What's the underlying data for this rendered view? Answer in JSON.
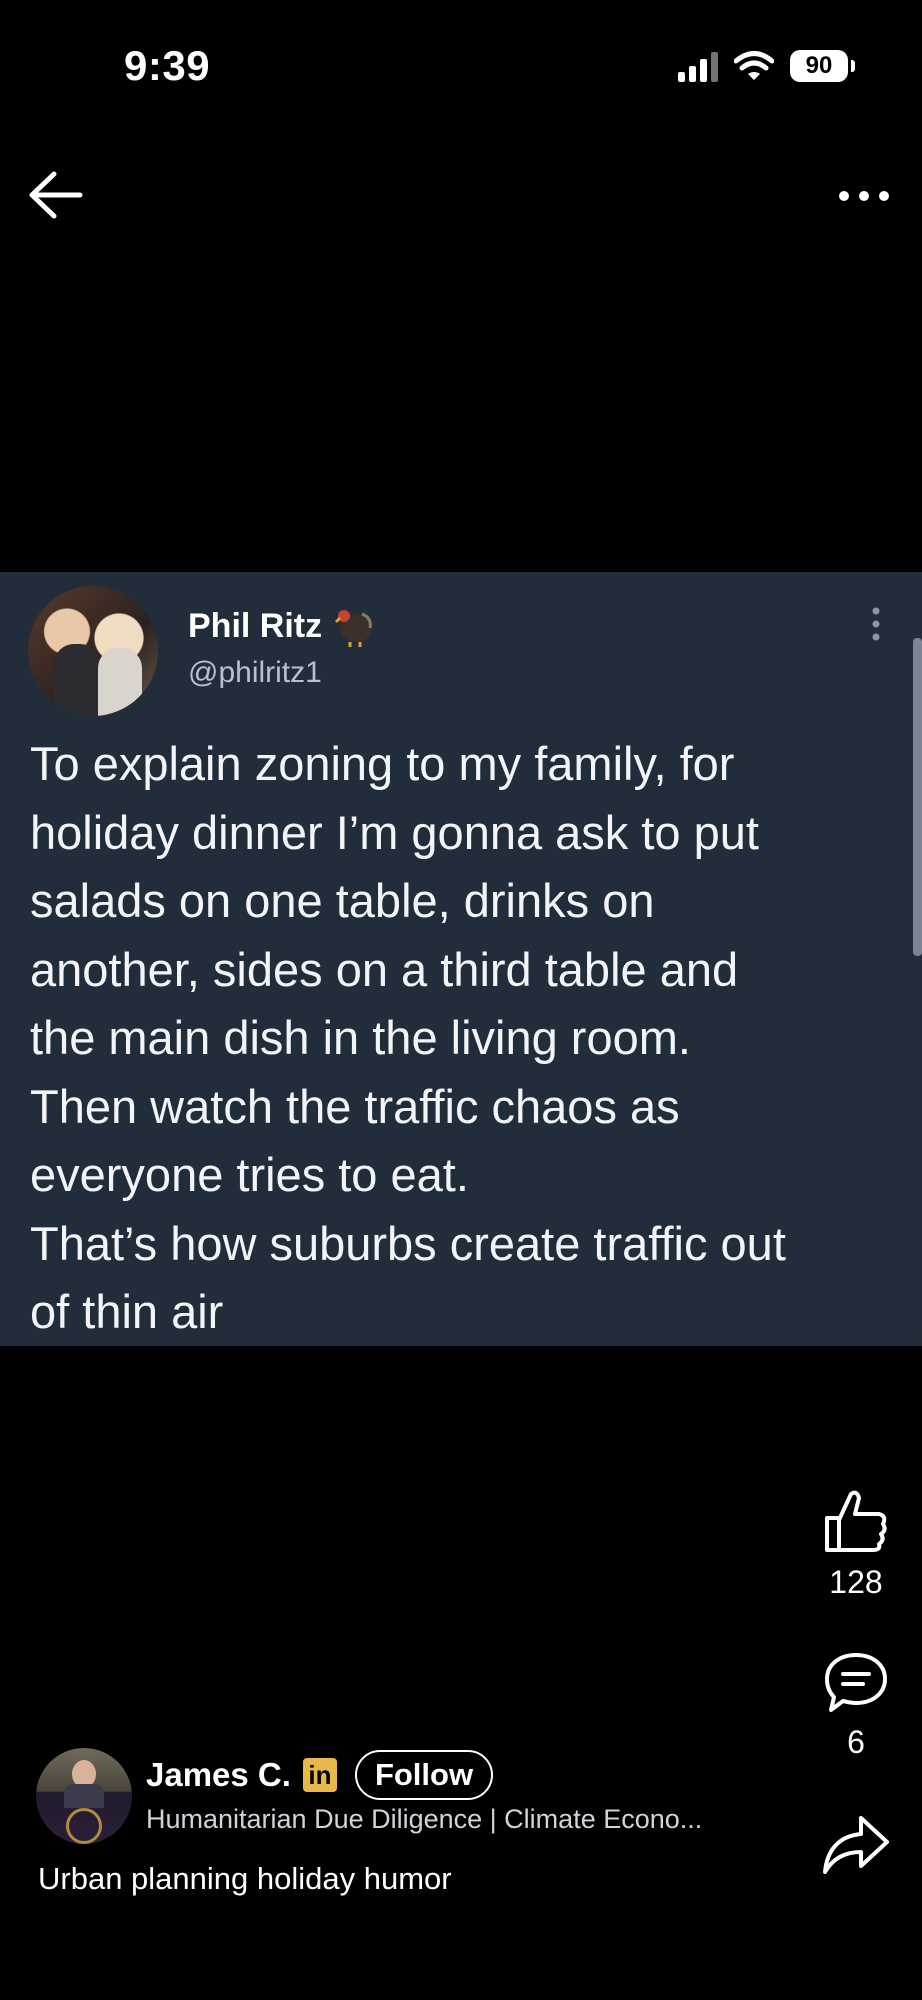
{
  "status_bar": {
    "time": "9:39",
    "battery": "90"
  },
  "nav": {
    "back_icon": "arrow-left-icon",
    "more_icon": "more-horizontal-icon"
  },
  "tweet": {
    "author_name": "Phil Ritz",
    "name_emoji_icon": "turkey-icon",
    "handle": "@philritz1",
    "lines": [
      "To explain zoning to my family, for",
      "holiday dinner I’m gonna ask to put",
      "salads on one table, drinks on",
      "another, sides on a third table and",
      "the main dish in the living room.",
      "Then watch the traffic chaos as",
      "everyone tries to eat.",
      "That’s how suburbs create traffic out",
      "of thin air"
    ],
    "background_color": "#222d3b"
  },
  "actions": {
    "like_count": "128",
    "comment_count": "6",
    "like_icon": "thumbs-up-icon",
    "comment_icon": "comment-icon",
    "share_icon": "share-icon"
  },
  "author": {
    "name": "James C.",
    "badge": "in",
    "follow_label": "Follow",
    "headline": "Humanitarian Due Diligence | Climate Econo...",
    "caption": "Urban planning holiday humor"
  }
}
